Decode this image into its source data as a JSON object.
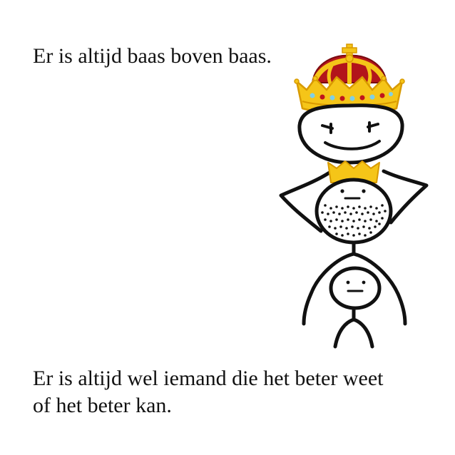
{
  "captions": {
    "top": "Er is altijd baas boven baas.",
    "bottom": "Er is altijd wel iemand die het beter weet\nof het beter kan."
  },
  "colors": {
    "crown_gold": "#f5c518",
    "crown_outline": "#d89a00",
    "crown_velvet": "#b2141b",
    "jewel_blue": "#7fd0e6",
    "jewel_red": "#c0141c",
    "ink": "#111111",
    "background": "#ffffff"
  }
}
